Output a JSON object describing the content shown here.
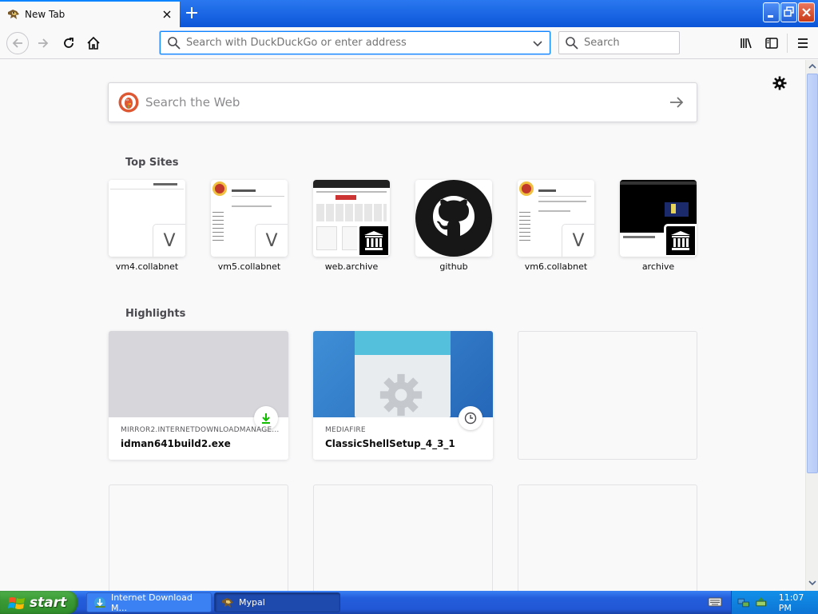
{
  "browser": {
    "tab": {
      "title": "New Tab"
    },
    "urlbar": {
      "placeholder": "Search with DuckDuckGo or enter address"
    },
    "searchbar": {
      "placeholder": "Search"
    }
  },
  "newtab": {
    "web_search_placeholder": "Search the Web",
    "top_sites_title": "Top Sites",
    "top_sites": [
      {
        "label": "vm4.collabnet",
        "badge": "V"
      },
      {
        "label": "vm5.collabnet",
        "badge": "V"
      },
      {
        "label": "web.archive",
        "badge": "archive-icon"
      },
      {
        "label": "github",
        "badge": "github-logo"
      },
      {
        "label": "vm6.collabnet",
        "badge": "V"
      },
      {
        "label": "archive",
        "badge": "archive-icon"
      }
    ],
    "highlights_title": "Highlights",
    "highlights": [
      {
        "source": "MIRROR2.INTERNETDOWNLOADMANAGE...",
        "name": "idman641build2.exe",
        "icon": "download-icon"
      },
      {
        "source": "MEDIAFIRE",
        "name": "ClassicShellSetup_4_3_1",
        "icon": "clock-icon"
      }
    ]
  },
  "taskbar": {
    "start_label": "start",
    "tasks": [
      {
        "label": "Internet Download M..."
      },
      {
        "label": "Mypal"
      }
    ],
    "clock": "11:07 PM"
  },
  "colors": {
    "accent": "#0a84ff",
    "titlebar": "#0b56d8",
    "download_green": "#12bc00",
    "xp_start_green": "#3b9a35"
  }
}
